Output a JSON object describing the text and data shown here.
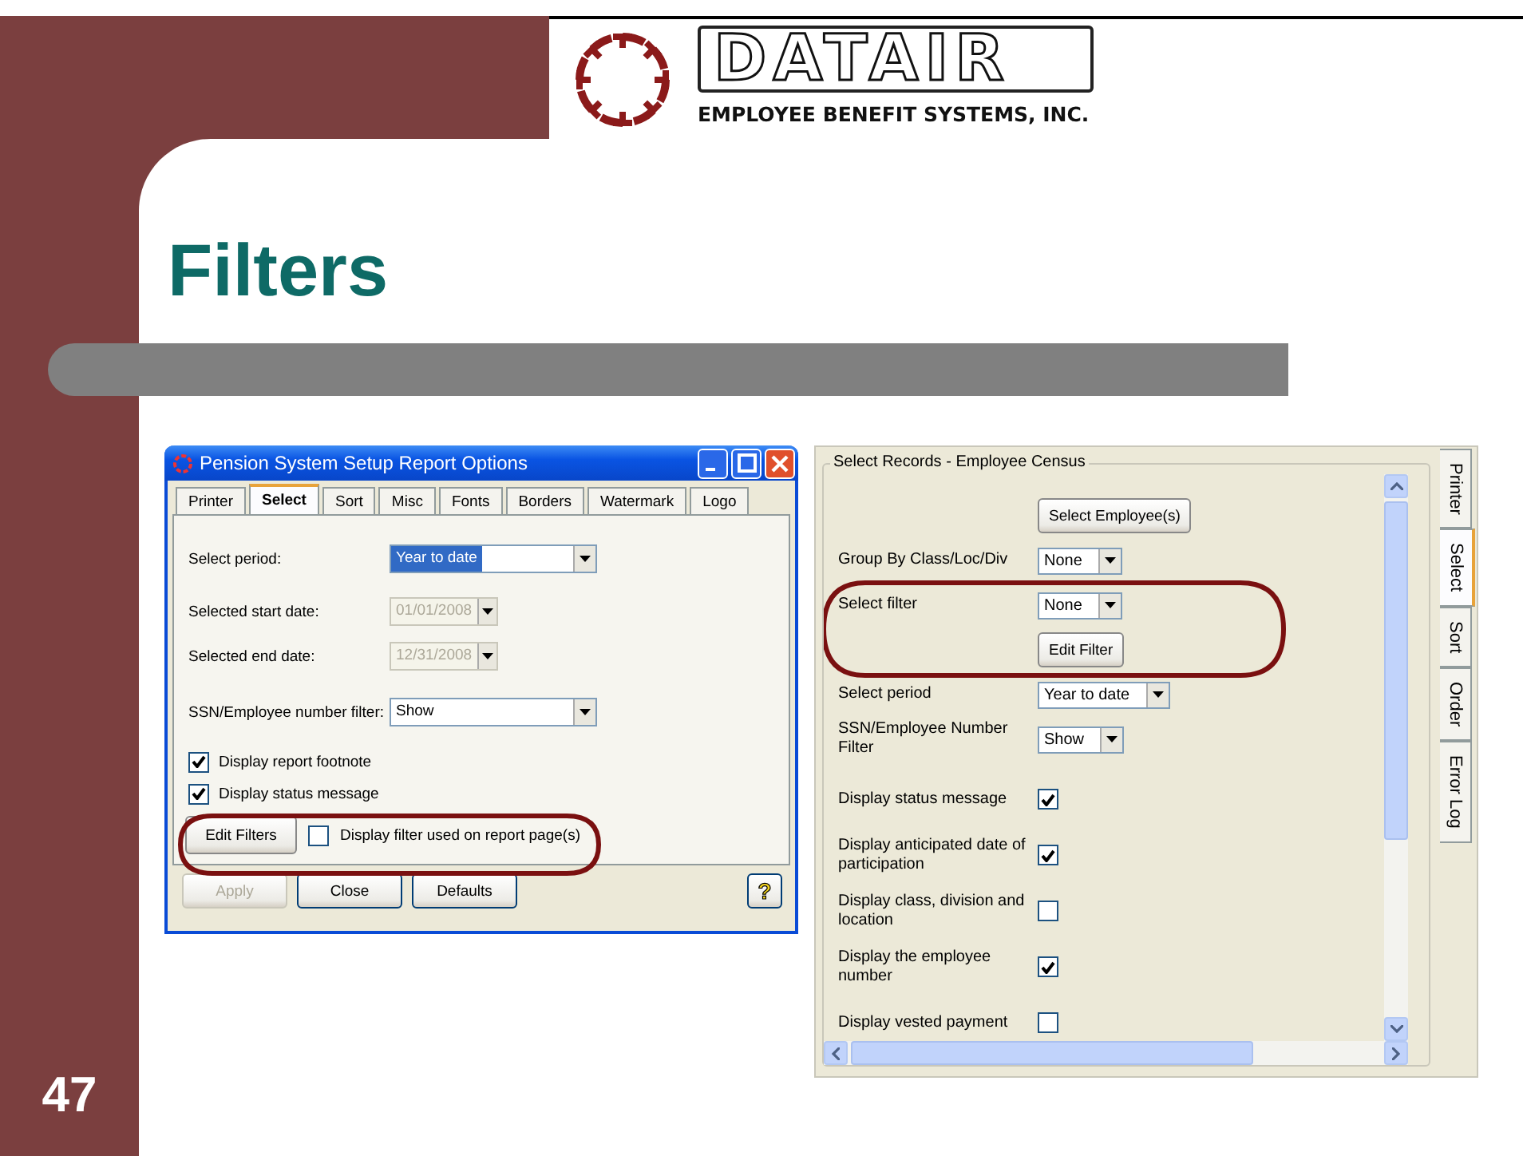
{
  "header": {
    "logo_wordmark": "DATAIR",
    "tagline": "EMPLOYEE BENEFIT SYSTEMS, INC."
  },
  "slide": {
    "title": "Filters",
    "page_number": "47"
  },
  "report_options_dialog": {
    "title": "Pension System Setup Report Options",
    "tabs": [
      {
        "label": "Printer",
        "selected": false
      },
      {
        "label": "Select",
        "selected": true
      },
      {
        "label": "Sort",
        "selected": false
      },
      {
        "label": "Misc",
        "selected": false
      },
      {
        "label": "Fonts",
        "selected": false
      },
      {
        "label": "Borders",
        "selected": false
      },
      {
        "label": "Watermark",
        "selected": false
      },
      {
        "label": "Logo",
        "selected": false
      }
    ],
    "fields": [
      {
        "label": "Select period:",
        "value": "Year to date",
        "disabled": false,
        "highlighted": true
      },
      {
        "label": "Selected start date:",
        "value": "01/01/2008",
        "disabled": true,
        "highlighted": false
      },
      {
        "label": "Selected end date:",
        "value": "12/31/2008",
        "disabled": true,
        "highlighted": false
      },
      {
        "label": "SSN/Employee number filter:",
        "value": "Show",
        "disabled": false,
        "highlighted": false
      }
    ],
    "checkboxes": [
      {
        "label": "Display report footnote",
        "checked": true
      },
      {
        "label": "Display status message",
        "checked": true
      }
    ],
    "edit_filters_button": "Edit Filters",
    "filter_checkbox": {
      "label": "Display filter used on report page(s)",
      "checked": false
    },
    "buttons": [
      {
        "label": "Apply",
        "disabled": true
      },
      {
        "label": "Close",
        "disabled": false
      },
      {
        "label": "Defaults",
        "disabled": false
      }
    ],
    "help_button": "?"
  },
  "census_panel": {
    "group_title": "Select Records - Employee Census",
    "rows": [
      {
        "kind": "button",
        "value": "Select Employee(s)"
      },
      {
        "kind": "dropdown",
        "label": "Group By Class/Loc/Div",
        "value": "None"
      },
      {
        "kind": "dropdown",
        "label": "Select filter",
        "value": "None"
      },
      {
        "kind": "button",
        "value": "Edit Filter"
      },
      {
        "kind": "dropdown",
        "label": "Select period",
        "value": "Year to date"
      },
      {
        "kind": "dropdown",
        "label": "SSN/Employee Number Filter",
        "value": "Show"
      },
      {
        "kind": "checkbox",
        "label": "Display status message",
        "checked": true
      },
      {
        "kind": "checkbox",
        "label": "Display anticipated date of participation",
        "checked": true
      },
      {
        "kind": "checkbox",
        "label": "Display class, division and location",
        "checked": false
      },
      {
        "kind": "checkbox",
        "label": "Display the employee number",
        "checked": true
      },
      {
        "kind": "checkbox",
        "label": "Display vested payment",
        "checked": false
      }
    ],
    "side_tabs": [
      {
        "label": "Printer",
        "selected": false
      },
      {
        "label": "Select",
        "selected": true
      },
      {
        "label": "Sort",
        "selected": false
      },
      {
        "label": "Order",
        "selected": false
      },
      {
        "label": "Error Log",
        "selected": false
      }
    ]
  }
}
